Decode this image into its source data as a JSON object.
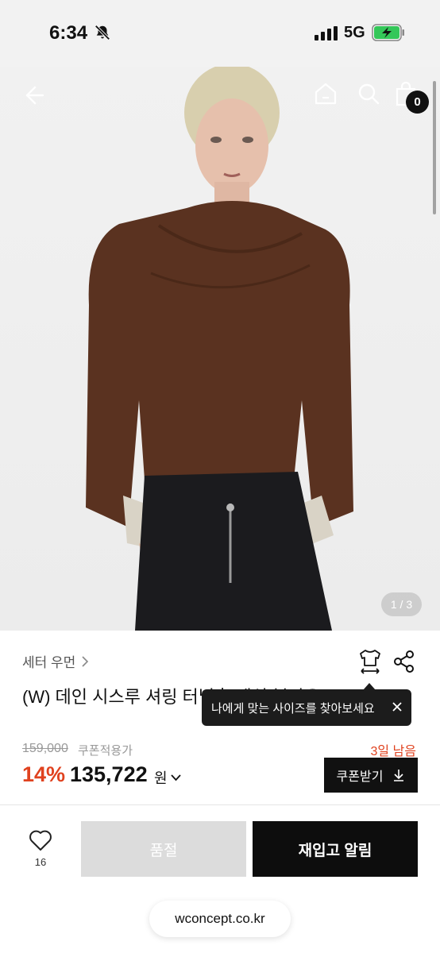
{
  "status_bar": {
    "time": "6:34",
    "network": "5G"
  },
  "hero": {
    "page_counter": "1 / 3",
    "cart_count": "0",
    "colors": {
      "garment": "#5a3220",
      "skirt": "#1b1b1e",
      "sleeve_cuff": "#d9d3c6"
    }
  },
  "product": {
    "category": "세터 우먼",
    "title": "(W) 데인 시스루 셔링 터널흘 메쉬 블라우",
    "tooltip": "나에게 맞는 사이즈를 찾아보세요",
    "original_price": "159,000",
    "coupon_note": "쿠폰적용가",
    "days_left": "3일 남음",
    "discount": "14%",
    "sale_price": "135,722",
    "currency": "원",
    "coupon_button": "쿠폰받기",
    "accent_color": "#e0421f"
  },
  "actions": {
    "like_count": "16",
    "soldout_label": "품절",
    "restock_label": "재입고 알림"
  },
  "browser": {
    "url": "wconcept.co.kr"
  },
  "icons": [
    "back-arrow-icon",
    "home-icon",
    "search-icon",
    "shopping-bag-icon",
    "size-guide-icon",
    "share-icon",
    "close-icon",
    "download-icon",
    "heart-icon",
    "chevron-right-icon",
    "chevron-down-icon",
    "bell-muted-icon",
    "signal-icon",
    "battery-charging-icon"
  ]
}
